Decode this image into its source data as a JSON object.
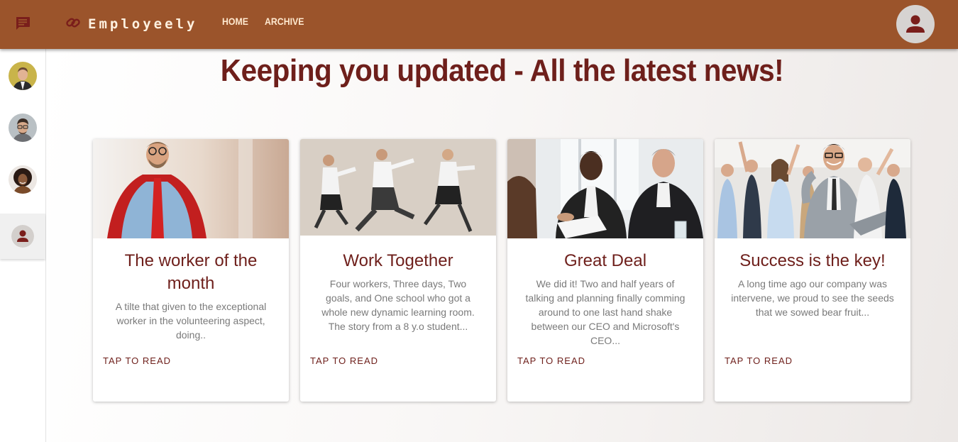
{
  "header": {
    "brand": "Employeely",
    "nav": [
      {
        "label": "HOME"
      },
      {
        "label": "ARCHIVE"
      }
    ]
  },
  "sidebar": {
    "items": [
      {
        "type": "photo",
        "name": "avatar-man-suit"
      },
      {
        "type": "photo",
        "name": "avatar-man-glasses"
      },
      {
        "type": "photo",
        "name": "avatar-woman-curly"
      },
      {
        "type": "icon",
        "name": "person-icon",
        "active": true
      }
    ]
  },
  "main": {
    "title": "Keeping you updated - All the latest news!",
    "cards": [
      {
        "image": "superhero-worker",
        "title": "The worker of the month",
        "text": "A tilte that given to the exceptional worker in the volunteering aspect, doing..",
        "action": "TAP TO READ"
      },
      {
        "image": "running-team",
        "title": "Work Together",
        "text": "Four workers, Three days, Two goals, and One school who got a whole new dynamic learning room. The story from a 8 y.o student...",
        "action": "TAP TO READ"
      },
      {
        "image": "handshake",
        "title": "Great Deal",
        "text": "We did it! Two and half years of talking and planning finally comming around to one last hand shake between our CEO and Microsoft's CEO...",
        "action": "TAP TO READ"
      },
      {
        "image": "celebrating-team",
        "title": "Success is the key!",
        "text": "A long time ago our company was intervene, we proud to see the seeds that we sowed bear fruit...",
        "action": "TAP TO READ"
      }
    ]
  },
  "colors": {
    "header": "#9b542b",
    "accent": "#6e1f1b",
    "muted_text": "#7a7a7a"
  }
}
